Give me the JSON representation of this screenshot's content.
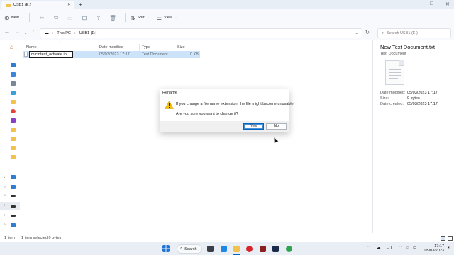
{
  "window": {
    "tab_title": "USB1 (E:)",
    "new_tab": "+",
    "controls": {
      "minimize": "–",
      "maximize": "□",
      "close": "✕"
    }
  },
  "toolbar": {
    "new_label": "New",
    "sort_label": "Sort",
    "view_label": "View",
    "more_label": "···"
  },
  "address": {
    "path": [
      "This PC",
      "USB1 (E:)"
    ],
    "search_placeholder": "Search USB1 (E:)"
  },
  "columns": [
    "Name",
    "Date modified",
    "Type",
    "Size"
  ],
  "files": [
    {
      "name": "micmtest_activate.ini",
      "date": "05/03/2023 17:17",
      "type": "Text Document",
      "size": "0 KB"
    }
  ],
  "details": {
    "title": "New Text Document.txt",
    "subtitle": "Text Document",
    "props": [
      {
        "label": "Date modified:",
        "value": "05/03/2023 17:17"
      },
      {
        "label": "Size:",
        "value": "0 bytes"
      },
      {
        "label": "Date created:",
        "value": "05/03/2023 17:17"
      }
    ]
  },
  "status": {
    "count": "1 item",
    "selected": "1 item selected 0 bytes"
  },
  "dialog": {
    "title": "Rename",
    "message": "If you change a file name extension, the file might become unusable.",
    "question": "Are you sure you want to change it?",
    "yes_label": "Yes",
    "no_label": "No"
  },
  "taskbar": {
    "search_label": "Search",
    "language": "LIT",
    "time": "17:17",
    "date": "05/03/2023"
  },
  "colors": {
    "selection": "#cce3f9",
    "accent": "#0067c0",
    "folder": "#f2c14e",
    "warning": "#f5c400"
  }
}
